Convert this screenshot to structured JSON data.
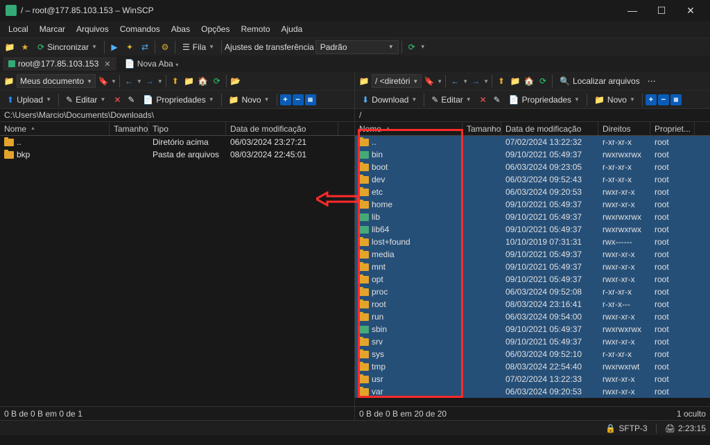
{
  "window": {
    "title": "/ – root@177.85.103.153 – WinSCP"
  },
  "menu": [
    "Local",
    "Marcar",
    "Arquivos",
    "Comandos",
    "Abas",
    "Opções",
    "Remoto",
    "Ajuda"
  ],
  "toolbar1": {
    "sync": "Sincronizar",
    "queue": "Fila",
    "transfer_label": "Ajustes de transferência",
    "transfer_value": "Padrão"
  },
  "tabs": {
    "active": "root@177.85.103.153",
    "new": "Nova Aba"
  },
  "local": {
    "dir_selector": "Meus documento",
    "find_files": "Localizar arquivos",
    "upload": "Upload",
    "edit": "Editar",
    "properties": "Propriedades",
    "new": "Novo",
    "path": "C:\\Users\\Marcio\\Documents\\Downloads\\",
    "cols": {
      "name": "Nome",
      "size": "Tamanho",
      "type": "Tipo",
      "date": "Data de modificação"
    },
    "rows": [
      {
        "icon": "folder",
        "name": "..",
        "size": "",
        "type": "Diretório acima",
        "date": "06/03/2024 23:27:21"
      },
      {
        "icon": "folder",
        "name": "bkp",
        "size": "",
        "type": "Pasta de arquivos",
        "date": "08/03/2024 22:45:01"
      }
    ],
    "footer": "0 B de 0 B em 0 de 1"
  },
  "remote": {
    "dir_selector": "/ <diretóri",
    "find_files": "Localizar arquivos",
    "download": "Download",
    "edit": "Editar",
    "properties": "Propriedades",
    "new": "Novo",
    "path": "/",
    "cols": {
      "name": "Nome",
      "size": "Tamanho",
      "date": "Data de modificação",
      "perm": "Direitos",
      "own": "Propriet..."
    },
    "rows": [
      {
        "icon": "folder",
        "name": "..",
        "sel": true,
        "date": "07/02/2024 13:22:32",
        "perm": "r-xr-xr-x",
        "own": "root"
      },
      {
        "icon": "link",
        "name": "bin",
        "sel": true,
        "date": "09/10/2021 05:49:37",
        "perm": "rwxrwxrwx",
        "own": "root"
      },
      {
        "icon": "folder",
        "name": "boot",
        "sel": true,
        "date": "06/03/2024 09:23:05",
        "perm": "r-xr-xr-x",
        "own": "root"
      },
      {
        "icon": "folder",
        "name": "dev",
        "sel": true,
        "date": "06/03/2024 09:52:43",
        "perm": "r-xr-xr-x",
        "own": "root"
      },
      {
        "icon": "folder",
        "name": "etc",
        "sel": true,
        "date": "06/03/2024 09:20:53",
        "perm": "rwxr-xr-x",
        "own": "root"
      },
      {
        "icon": "folder",
        "name": "home",
        "sel": true,
        "date": "09/10/2021 05:49:37",
        "perm": "rwxr-xr-x",
        "own": "root"
      },
      {
        "icon": "link",
        "name": "lib",
        "sel": true,
        "date": "09/10/2021 05:49:37",
        "perm": "rwxrwxrwx",
        "own": "root"
      },
      {
        "icon": "link",
        "name": "lib64",
        "sel": true,
        "date": "09/10/2021 05:49:37",
        "perm": "rwxrwxrwx",
        "own": "root"
      },
      {
        "icon": "folder",
        "name": "lost+found",
        "sel": true,
        "date": "10/10/2019 07:31:31",
        "perm": "rwx------",
        "own": "root"
      },
      {
        "icon": "folder",
        "name": "media",
        "sel": true,
        "date": "09/10/2021 05:49:37",
        "perm": "rwxr-xr-x",
        "own": "root"
      },
      {
        "icon": "folder",
        "name": "mnt",
        "sel": true,
        "date": "09/10/2021 05:49:37",
        "perm": "rwxr-xr-x",
        "own": "root"
      },
      {
        "icon": "folder",
        "name": "opt",
        "sel": true,
        "date": "09/10/2021 05:49:37",
        "perm": "rwxr-xr-x",
        "own": "root"
      },
      {
        "icon": "folder",
        "name": "proc",
        "sel": true,
        "date": "06/03/2024 09:52:08",
        "perm": "r-xr-xr-x",
        "own": "root"
      },
      {
        "icon": "folder",
        "name": "root",
        "sel": true,
        "date": "08/03/2024 23:16:41",
        "perm": "r-xr-x---",
        "own": "root"
      },
      {
        "icon": "folder",
        "name": "run",
        "sel": true,
        "date": "06/03/2024 09:54:00",
        "perm": "rwxr-xr-x",
        "own": "root"
      },
      {
        "icon": "link",
        "name": "sbin",
        "sel": true,
        "date": "09/10/2021 05:49:37",
        "perm": "rwxrwxrwx",
        "own": "root"
      },
      {
        "icon": "folder",
        "name": "srv",
        "sel": true,
        "date": "09/10/2021 05:49:37",
        "perm": "rwxr-xr-x",
        "own": "root"
      },
      {
        "icon": "folder",
        "name": "sys",
        "sel": true,
        "date": "06/03/2024 09:52:10",
        "perm": "r-xr-xr-x",
        "own": "root"
      },
      {
        "icon": "folder",
        "name": "tmp",
        "sel": true,
        "date": "08/03/2024 22:54:40",
        "perm": "rwxrwxrwt",
        "own": "root"
      },
      {
        "icon": "folder",
        "name": "usr",
        "sel": true,
        "date": "07/02/2024 13:22:33",
        "perm": "rwxr-xr-x",
        "own": "root"
      },
      {
        "icon": "folder",
        "name": "var",
        "sel": true,
        "date": "06/03/2024 09:20:53",
        "perm": "rwxr-xr-x",
        "own": "root"
      }
    ],
    "footer_left": "0 B de 0 B em 20 de 20",
    "footer_right": "1 oculto"
  },
  "status": {
    "protocol": "SFTP-3",
    "time": "2:23:15"
  }
}
